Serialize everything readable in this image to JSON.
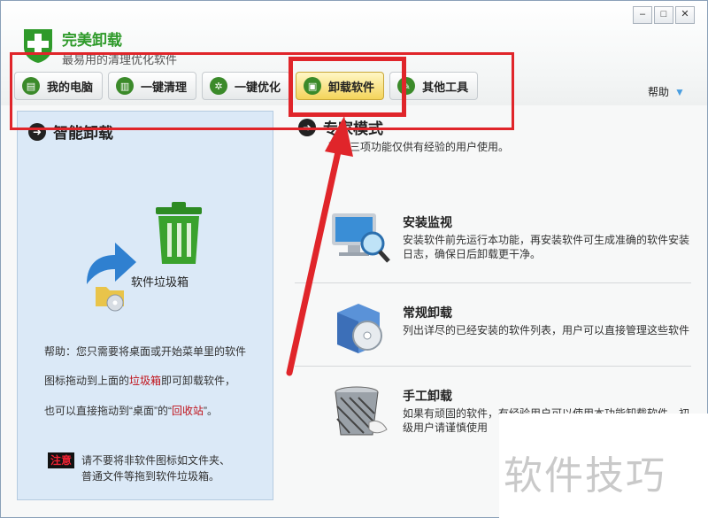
{
  "app": {
    "title": "完美卸载",
    "subtitle": "最易用的清理优化软件"
  },
  "window_controls": {
    "minimize": "–",
    "maximize": "□",
    "close": "✕"
  },
  "tabs": [
    {
      "label": "我的电脑",
      "icon": "computer-icon",
      "active": false,
      "color": "#3b8a2a"
    },
    {
      "label": "一键清理",
      "icon": "trash-icon",
      "active": false,
      "color": "#3b8a2a"
    },
    {
      "label": "一键优化",
      "icon": "gear-icon",
      "active": false,
      "color": "#3b8a2a"
    },
    {
      "label": "卸载软件",
      "icon": "uninstall-icon",
      "active": true,
      "color": "#3b8a2a"
    },
    {
      "label": "其他工具",
      "icon": "tools-icon",
      "active": false,
      "color": "#3b8a2a"
    }
  ],
  "help": {
    "label": "帮助",
    "icon": "chevron-down-icon"
  },
  "left_panel": {
    "title": "智能卸载",
    "trash_label": "软件垃圾箱",
    "help_line1": "帮助：您只需要将桌面或开始菜单里的软件",
    "help_line2_pre": "图标拖动到上面的",
    "help_line2_link": "垃圾箱",
    "help_line2_post": "即可卸载软件，",
    "help_line3_pre": "也可以直接拖动到“桌面”的“",
    "help_line3_link": "回收站",
    "help_line3_post": "”。",
    "note_badge": "注意",
    "note_line1": "请不要将非软件图标如文件夹、",
    "note_line2": "普通文件等拖到软件垃圾箱。"
  },
  "right_panel": {
    "title": "专家模式",
    "desc": "下面三项功能仅供有经验的用户使用。",
    "features": [
      {
        "title": "安装监视",
        "desc": "安装软件前先运行本功能，再安装软件可生成准确的软件安装日志，确保日后卸载更干净。",
        "icon": "monitor-magnifier-icon"
      },
      {
        "title": "常规卸载",
        "desc": "列出详尽的已经安装的软件列表，用户可以直接管理这些软件",
        "icon": "software-box-icon"
      },
      {
        "title": "手工卸载",
        "desc": "如果有顽固的软件，有经验用户可以使用本功能卸载软件，初级用户请谨慎使用",
        "icon": "wastebasket-icon"
      }
    ]
  },
  "watermark": "软件技巧",
  "colors": {
    "accent_green": "#2f9a2a",
    "highlight_red": "#e0252a",
    "panel_blue": "#dbe9f7"
  }
}
